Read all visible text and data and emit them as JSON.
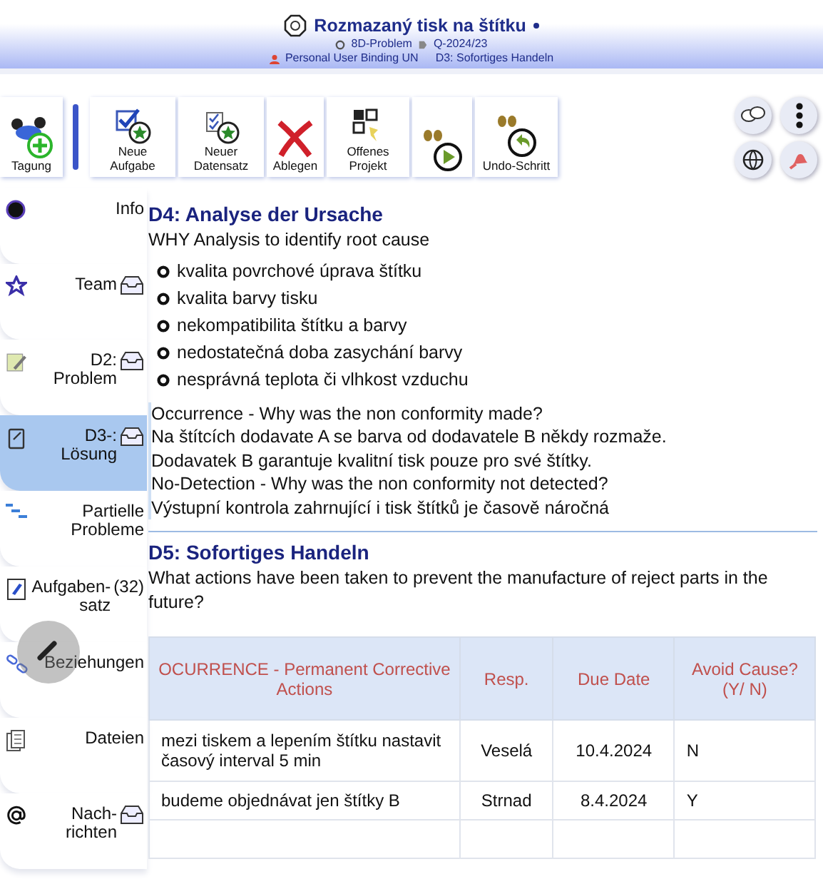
{
  "header": {
    "title": "Rozmazaný tisk na štítku",
    "type": "8D-Problem",
    "number": "Q-2024/23",
    "user": "Personal User Binding UN",
    "step": "D3: Sofortiges Handeln"
  },
  "toolbar": [
    {
      "kind": "meeting",
      "label": "Tagung"
    },
    {
      "kind": "separator"
    },
    {
      "kind": "new-task",
      "label": "Neue Aufgabe"
    },
    {
      "kind": "new-record",
      "label": "Neuer Datensatz"
    },
    {
      "kind": "discard",
      "label": "Ablegen"
    },
    {
      "kind": "open-project",
      "label": "Offenes Projekt"
    },
    {
      "kind": "step-forward"
    },
    {
      "kind": "undo",
      "label": "Undo-Schritt"
    }
  ],
  "sidebar": {
    "items": [
      {
        "kind": "dot",
        "label": "Info",
        "inbox": false,
        "selected": false
      },
      {
        "kind": "star",
        "label": "Team",
        "inbox": true,
        "selected": false
      },
      {
        "kind": "note",
        "label": "D2: Problem",
        "inbox": true,
        "selected": false
      },
      {
        "kind": "clipboard",
        "label": "D3-: Lösung",
        "inbox": true,
        "selected": true
      },
      {
        "kind": "steps",
        "label": "Partielle Probleme",
        "inbox": false,
        "selected": false
      },
      {
        "kind": "task",
        "label": "Aufgaben-satz",
        "count": "(32)",
        "inbox": false,
        "selected": false
      },
      {
        "kind": "link",
        "label": "Beziehungen",
        "inbox": false,
        "selected": false
      },
      {
        "kind": "files",
        "label": "Dateien",
        "inbox": false,
        "selected": false
      },
      {
        "kind": "at",
        "label": "Nach-richten",
        "inbox": true,
        "selected": false
      }
    ]
  },
  "d4": {
    "heading": "D4: Analyse der Ursache",
    "intro": "WHY Analysis to identify root cause",
    "causes": [
      "kvalita povrchové úprava štítku",
      "kvalita barvy tisku",
      "nekompatibilita štítku a barvy",
      "nedostatečná doba zasychání barvy",
      "nesprávná teplota či vlhkost vzduchu"
    ],
    "lines": [
      "Occurrence - Why was the non conformity made?",
      "Na štítcích dodavate A se barva od dodavatele B někdy rozmaže.",
      "Dodavatek B garantuje kvalitní tisk pouze pro své štítky.",
      "No-Detection - Why was the non conformity not detected?",
      "Výstupní kontrola zahrnující i tisk štítků je časově náročná"
    ]
  },
  "d5": {
    "heading": "D5: Sofortiges Handeln",
    "question": "What actions have been taken to prevent the manufacture of reject parts in the future?",
    "table": {
      "columns": [
        "OCURRENCE - Permanent Corrective Actions",
        "Resp.",
        "Due Date",
        "Avoid Cause? (Y/ N)"
      ],
      "rows": [
        [
          "mezi tiskem a lepením štítku nastavit časový interval 5 min",
          "Veselá",
          "10.4.2024",
          "N"
        ],
        [
          "budeme objednávat jen štítky B",
          "Strnad",
          "8.4.2024",
          "Y"
        ]
      ]
    }
  }
}
